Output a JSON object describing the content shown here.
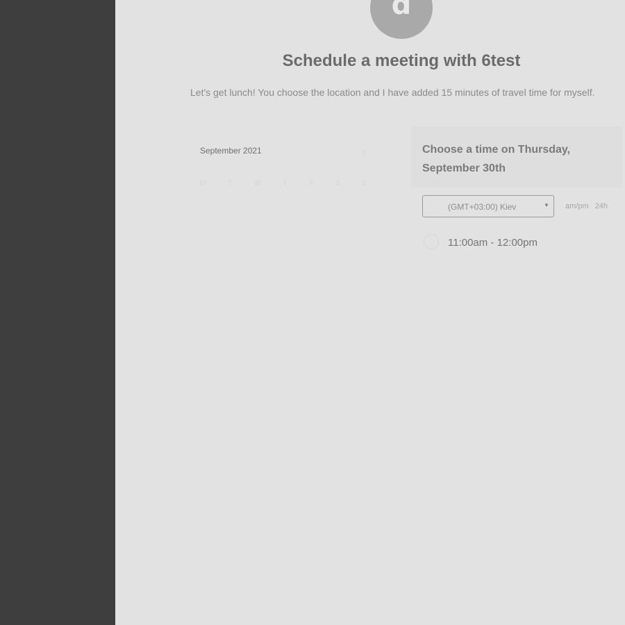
{
  "host": {
    "avatar_letter": "d",
    "title": "Schedule a meeting with 6test",
    "description": "Let's get lunch! You choose the location and I have added 15 minutes of travel time for myself."
  },
  "calendar": {
    "month_label": "September 2021",
    "next_icon": "chevron-right-icon",
    "weekdays": [
      "M",
      "T",
      "W",
      "T",
      "F",
      "S",
      "S"
    ]
  },
  "timeslots": {
    "heading": "Choose a time on Thursday, September 30th",
    "timezone": "(GMT+03:00) Kiev",
    "format_options": [
      "am/pm",
      "24h"
    ],
    "slots": [
      {
        "label": "11:00am - 12:00pm"
      }
    ]
  },
  "colors": {
    "sidebar": "#3e3e3e",
    "background": "#e2e2e2",
    "avatar": "#a9a9a9"
  }
}
